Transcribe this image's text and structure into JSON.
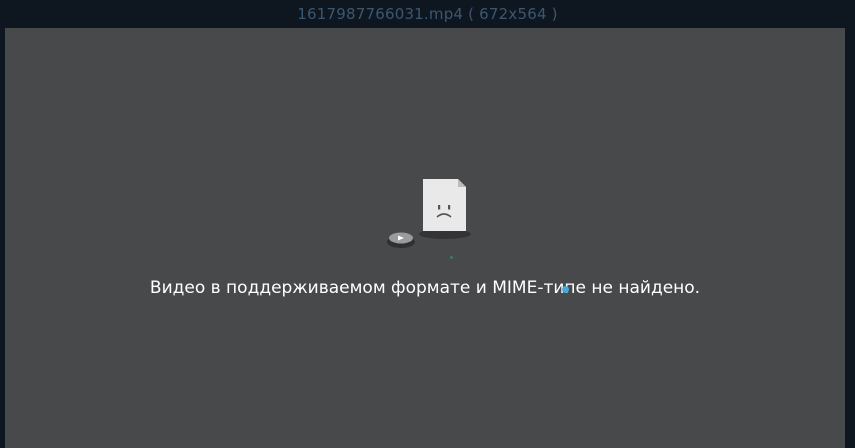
{
  "window": {
    "title": "1617987766031.mp4 ( 672x564 )"
  },
  "player": {
    "error_message": "Видео в поддерживаемом формате и MIME-типе не найдено.",
    "error_icon": "sad-file-icon",
    "disc_icon": "disc-play-icon"
  },
  "colors": {
    "frame": "#0e1720",
    "title_text": "#3d5670",
    "video_bg": "#48494b",
    "message_text": "#ffffff"
  }
}
